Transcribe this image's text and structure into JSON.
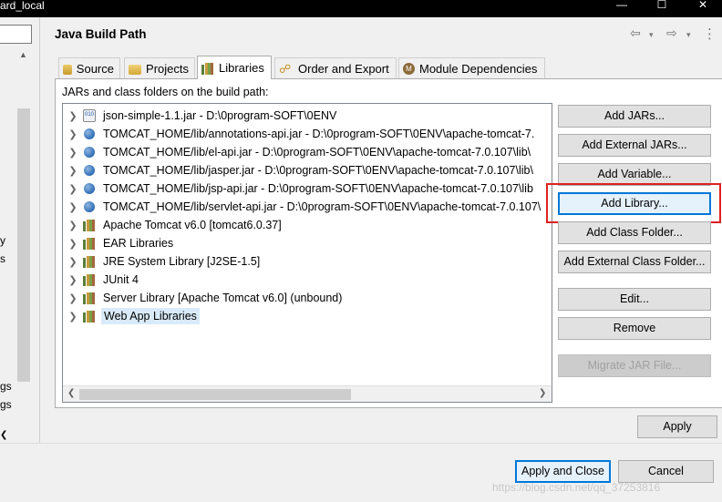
{
  "window": {
    "title": "ard_local",
    "minimize": "—",
    "maximize": "☐",
    "close": "✕"
  },
  "left": {
    "fragments": [
      "y",
      "s",
      "gs",
      "gs"
    ]
  },
  "header": {
    "title": "Java Build Path"
  },
  "tabs": [
    {
      "label": "Source"
    },
    {
      "label": "Projects"
    },
    {
      "label": "Libraries",
      "selected": true
    },
    {
      "label": "Order and Export"
    },
    {
      "label": "Module Dependencies"
    }
  ],
  "libraries": {
    "description": "JARs and class folders on the build path:",
    "entries": [
      {
        "label": "json-simple-1.1.jar - D:\\0program-SOFT\\0ENV",
        "icon": "jar-icon"
      },
      {
        "label": "TOMCAT_HOME/lib/annotations-api.jar - D:\\0program-SOFT\\0ENV\\apache-tomcat-7.",
        "icon": "variable-jar-icon"
      },
      {
        "label": "TOMCAT_HOME/lib/el-api.jar - D:\\0program-SOFT\\0ENV\\apache-tomcat-7.0.107\\lib\\",
        "icon": "variable-jar-icon"
      },
      {
        "label": "TOMCAT_HOME/lib/jasper.jar - D:\\0program-SOFT\\0ENV\\apache-tomcat-7.0.107\\lib\\",
        "icon": "variable-jar-icon"
      },
      {
        "label": "TOMCAT_HOME/lib/jsp-api.jar - D:\\0program-SOFT\\0ENV\\apache-tomcat-7.0.107\\lib",
        "icon": "variable-jar-icon"
      },
      {
        "label": "TOMCAT_HOME/lib/servlet-api.jar - D:\\0program-SOFT\\0ENV\\apache-tomcat-7.0.107\\",
        "icon": "variable-jar-icon"
      },
      {
        "label": "Apache Tomcat v6.0 [tomcat6.0.37]",
        "icon": "library-icon"
      },
      {
        "label": "EAR Libraries",
        "icon": "library-icon"
      },
      {
        "label": "JRE System Library [J2SE-1.5]",
        "icon": "library-icon"
      },
      {
        "label": "JUnit 4",
        "icon": "library-icon"
      },
      {
        "label": "Server Library [Apache Tomcat v6.0] (unbound)",
        "icon": "library-icon"
      },
      {
        "label": "Web App Libraries",
        "icon": "library-icon",
        "selected": true
      }
    ]
  },
  "buttons": {
    "add_jars": "Add JARs...",
    "add_external_jars": "Add External JARs...",
    "add_variable": "Add Variable...",
    "add_library": "Add Library...",
    "add_class_folder": "Add Class Folder...",
    "add_external_class_folder": "Add External Class Folder...",
    "edit": "Edit...",
    "remove": "Remove",
    "migrate_jar": "Migrate JAR File...",
    "apply": "Apply",
    "apply_and_close": "Apply and Close",
    "cancel": "Cancel"
  },
  "watermark": "https://blog.csdn.net/qq_37253816",
  "colors": {
    "highlight_box": "#e02020",
    "selection": "#d9ebf9",
    "default_button_border": "#0078d7"
  }
}
